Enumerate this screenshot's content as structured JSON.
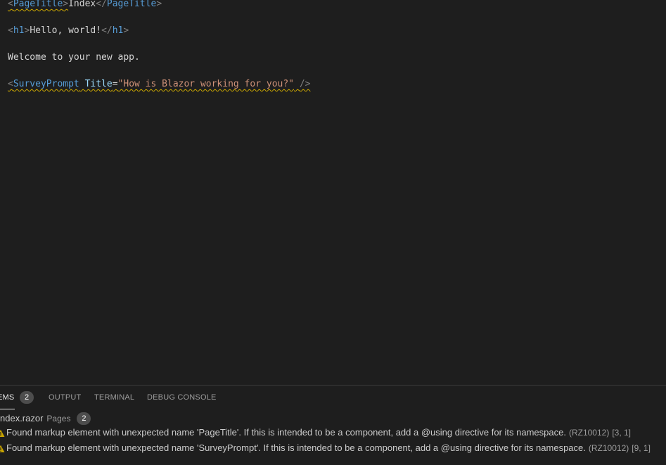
{
  "editor": {
    "line1": {
      "open_lt": "<",
      "tag_open": "PageTitle",
      "open_gt": ">",
      "content": "Index",
      "close_lt": "</",
      "tag_close": "PageTitle",
      "close_gt": ">"
    },
    "line2": {
      "open_lt": "<",
      "tag_open": "h1",
      "open_gt": ">",
      "content": "Hello, world!",
      "close_lt": "</",
      "tag_close": "h1",
      "close_gt": ">"
    },
    "line3": {
      "text": "Welcome to your new app."
    },
    "line4": {
      "open_lt": "<",
      "tag": "SurveyPrompt",
      "attr_name": "Title",
      "equals": "=",
      "attr_value": "\"How is Blazor working for you?\"",
      "self_close": "/>"
    }
  },
  "panel": {
    "tabs": [
      {
        "label": "EMS",
        "badge": "2",
        "active": true
      },
      {
        "label": "OUTPUT"
      },
      {
        "label": "TERMINAL"
      },
      {
        "label": "DEBUG CONSOLE"
      }
    ],
    "file": {
      "name": "ndex.razor",
      "folder": "Pages",
      "count": "2"
    },
    "problems": [
      {
        "icon": "warning-icon",
        "message": "Found markup element with unexpected name 'PageTitle'. If this is intended to be a component, add a @using directive for its namespace.",
        "code": "(RZ10012)",
        "position": "[3, 1]"
      },
      {
        "icon": "warning-icon",
        "message": "Found markup element with unexpected name 'SurveyPrompt'. If this is intended to be a component, add a @using directive for its namespace.",
        "code": "(RZ10012)",
        "position": "[9, 1]"
      }
    ]
  },
  "colors": {
    "background": "#1e1e1e",
    "tag": "#569cd6",
    "attribute": "#9cdcfe",
    "string": "#ce9178",
    "warning": "#cca700"
  }
}
